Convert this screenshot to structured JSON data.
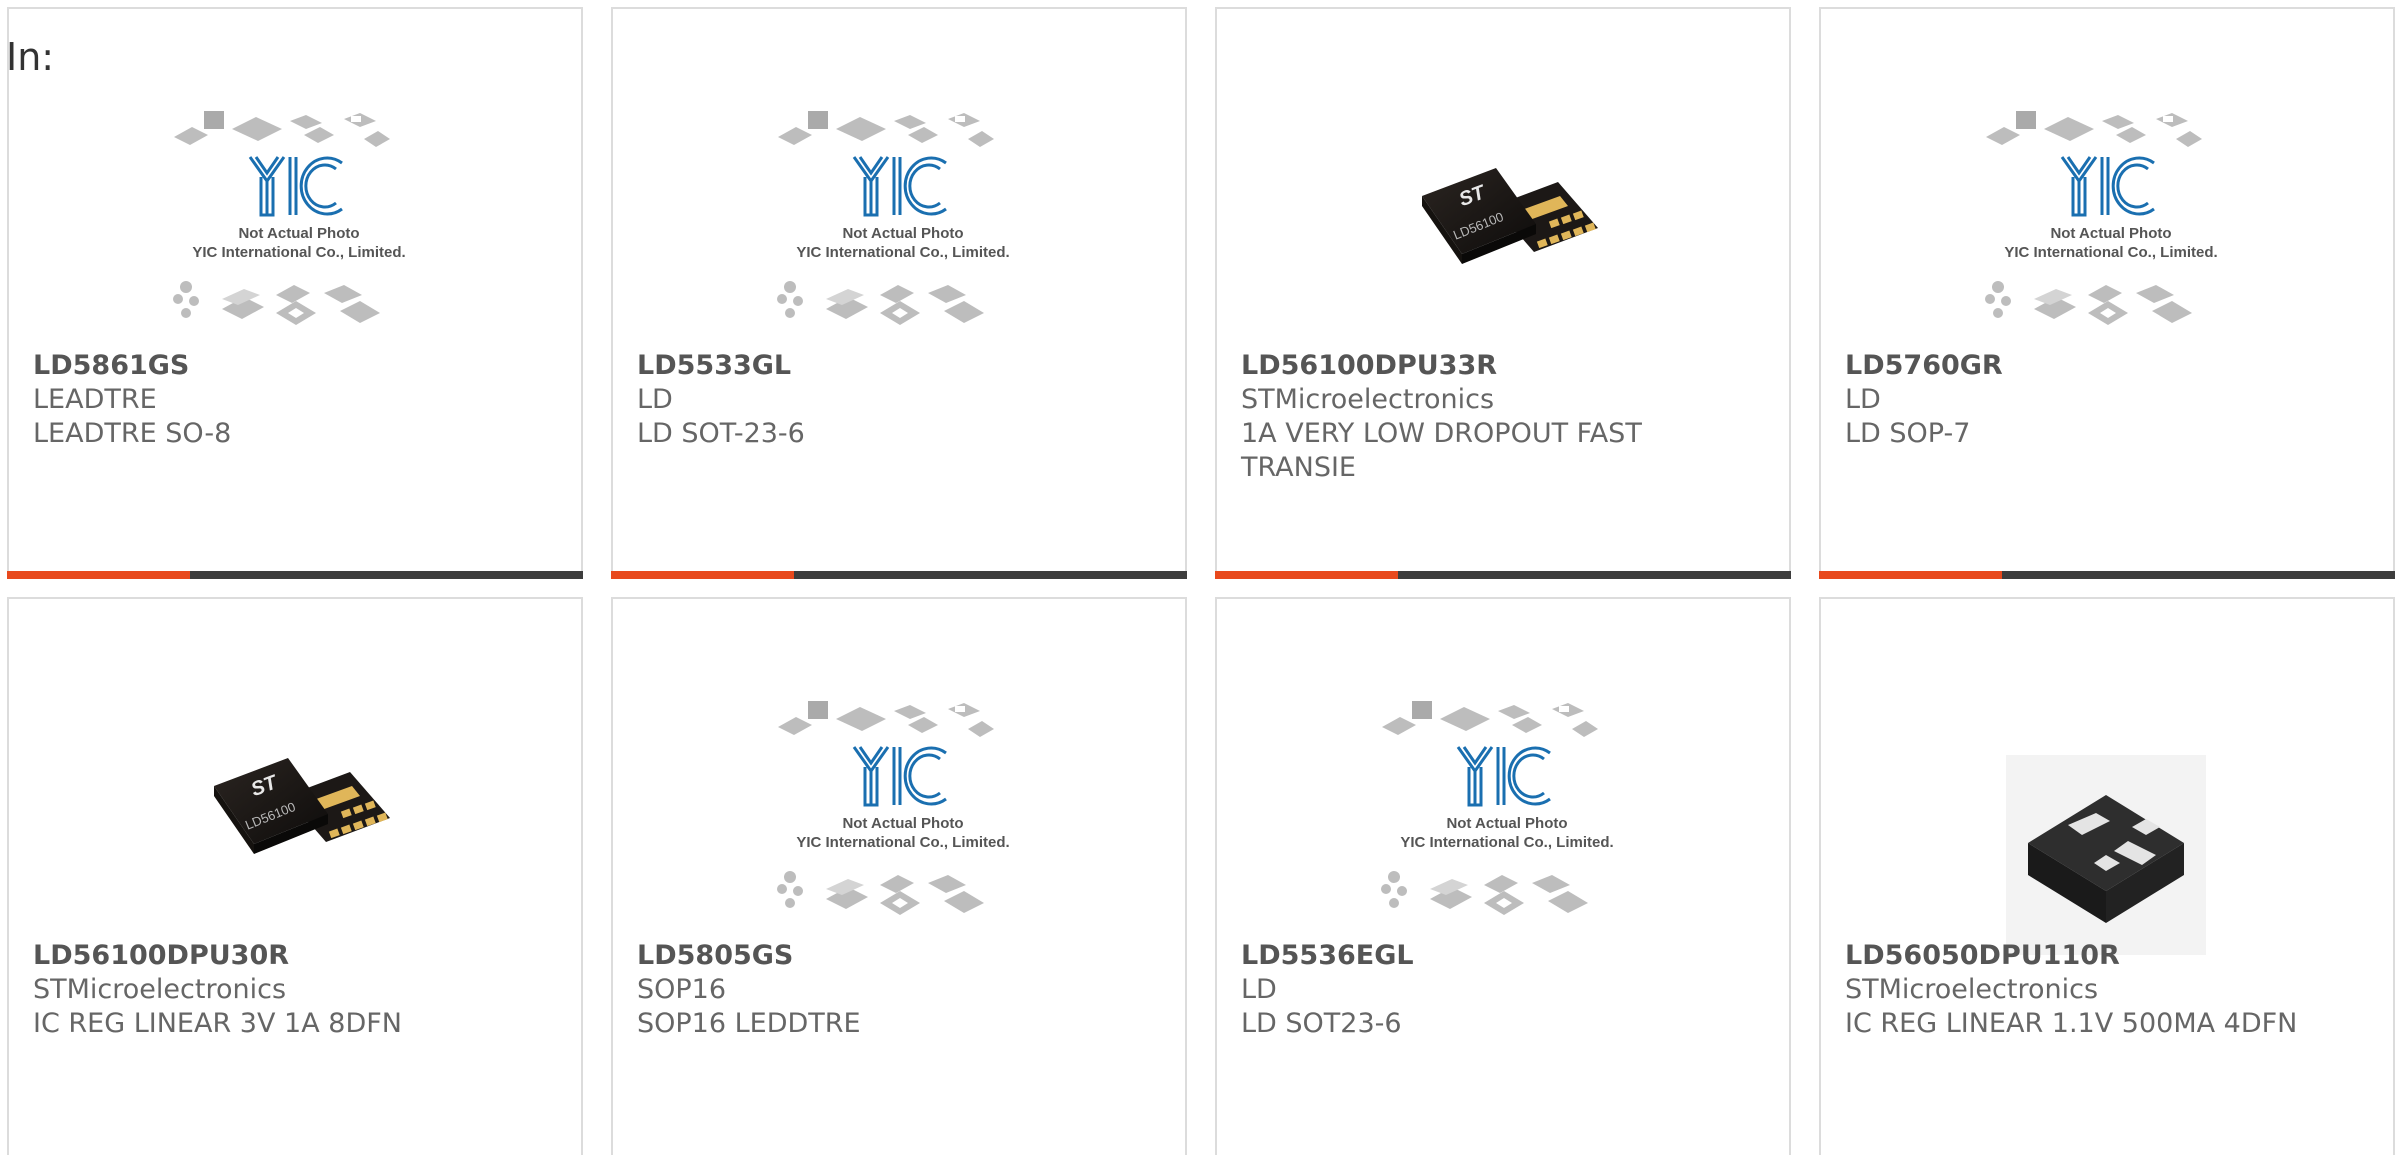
{
  "header": {
    "label": "In:"
  },
  "placeholder": {
    "line1": "Not Actual Photo",
    "line2": "YIC International Co., Limited."
  },
  "colors": {
    "accent": "#e8491d",
    "bar": "#3d3d3d",
    "logo": "#1a6fb0"
  },
  "products": [
    {
      "part": "LD5861GS",
      "maker": "LEADTRE",
      "desc": "LEADTRE SO-8",
      "image": "yic-placeholder"
    },
    {
      "part": "LD5533GL",
      "maker": "LD",
      "desc": "LD SOT-23-6",
      "image": "yic-placeholder"
    },
    {
      "part": "LD56100DPU33R",
      "maker": "STMicroelectronics",
      "desc": "1A VERY LOW DROPOUT FAST TRANSIE",
      "image": "st-chip",
      "chip_text": "LD56100"
    },
    {
      "part": "LD5760GR",
      "maker": "LD",
      "desc": "LD SOP-7",
      "image": "yic-placeholder"
    },
    {
      "part": "LD56100DPU30R",
      "maker": "STMicroelectronics",
      "desc": "IC REG LINEAR 3V 1A 8DFN",
      "image": "st-chip",
      "chip_text": "LD56100"
    },
    {
      "part": "LD5805GS",
      "maker": "SOP16",
      "desc": "SOP16 LEDDTRE",
      "image": "yic-placeholder"
    },
    {
      "part": "LD5536EGL",
      "maker": "LD",
      "desc": "LD SOT23-6",
      "image": "yic-placeholder"
    },
    {
      "part": "LD56050DPU110R",
      "maker": "STMicroelectronics",
      "desc": "IC REG LINEAR 1.1V 500MA 4DFN",
      "image": "dfn-package"
    }
  ]
}
